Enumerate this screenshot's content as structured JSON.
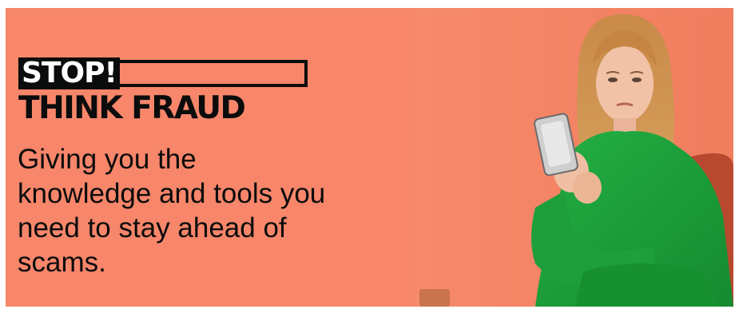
{
  "logo": {
    "line1": "STOP!",
    "line2": "THINK FRAUD"
  },
  "tagline": {
    "lines": [
      "Giving you the",
      "knowledge and tools you",
      "need to stay ahead of",
      "scams."
    ]
  },
  "photo": {
    "description_icon": "woman-looking-at-phone-photo"
  },
  "colors": {
    "background": "#f7866a",
    "text": "#0b0c0c",
    "sweater": "#1fa23a"
  }
}
